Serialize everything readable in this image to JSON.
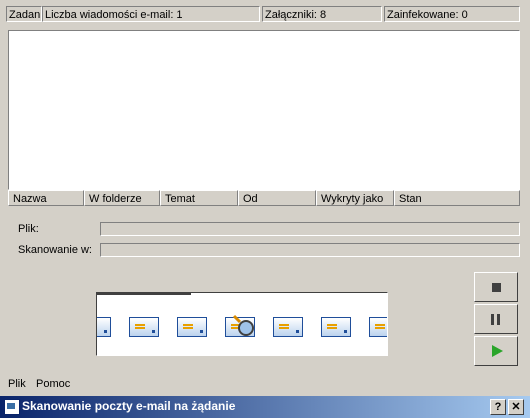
{
  "window": {
    "title": "Skanowanie poczty e-mail na żądanie",
    "help_glyph": "?",
    "close_glyph": "✕"
  },
  "menu": [
    "Plik",
    "Pomoc"
  ],
  "status": {
    "tasks": "Zadani",
    "email_count": "Liczba wiadomości e-mail: 1",
    "attachments": "Załączniki: 8",
    "infected": "Zainfekowane: 0"
  },
  "columns": [
    "Nazwa",
    "W folderze",
    "Temat",
    "Od",
    "Wykryty jako",
    "Stan"
  ],
  "fields": {
    "file_label": "Plik:",
    "scanning_label": "Skanowanie w:"
  },
  "icons": {
    "stop": "stop-icon",
    "pause": "pause-icon",
    "play": "play-icon",
    "scan": "magnifier-icon",
    "envelope": "envelope-icon"
  },
  "colors": {
    "face": "#d4d0c8",
    "title_start": "#0a246a",
    "title_end": "#a6caf0",
    "play": "#2aa52a"
  }
}
